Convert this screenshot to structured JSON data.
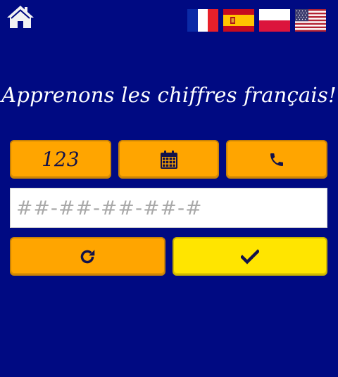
{
  "app": {
    "title": "Apprenons les chiffres français!"
  },
  "nav": {
    "home_icon": "home-icon"
  },
  "languages": [
    {
      "name": "flag-france-icon"
    },
    {
      "name": "flag-spain-icon"
    },
    {
      "name": "flag-poland-icon"
    },
    {
      "name": "flag-usa-icon"
    }
  ],
  "modes": {
    "numbers_label": "123",
    "calendar_icon": "calendar-icon",
    "phone_icon": "phone-icon"
  },
  "answer": {
    "value": "",
    "placeholder": "##-##-##-##-#"
  },
  "actions": {
    "refresh_icon": "refresh-icon",
    "check_icon": "checkmark-icon"
  },
  "colors": {
    "background": "#000a82",
    "mode_button": "#ffa500",
    "check_button": "#ffe500",
    "icon": "#12124a"
  }
}
